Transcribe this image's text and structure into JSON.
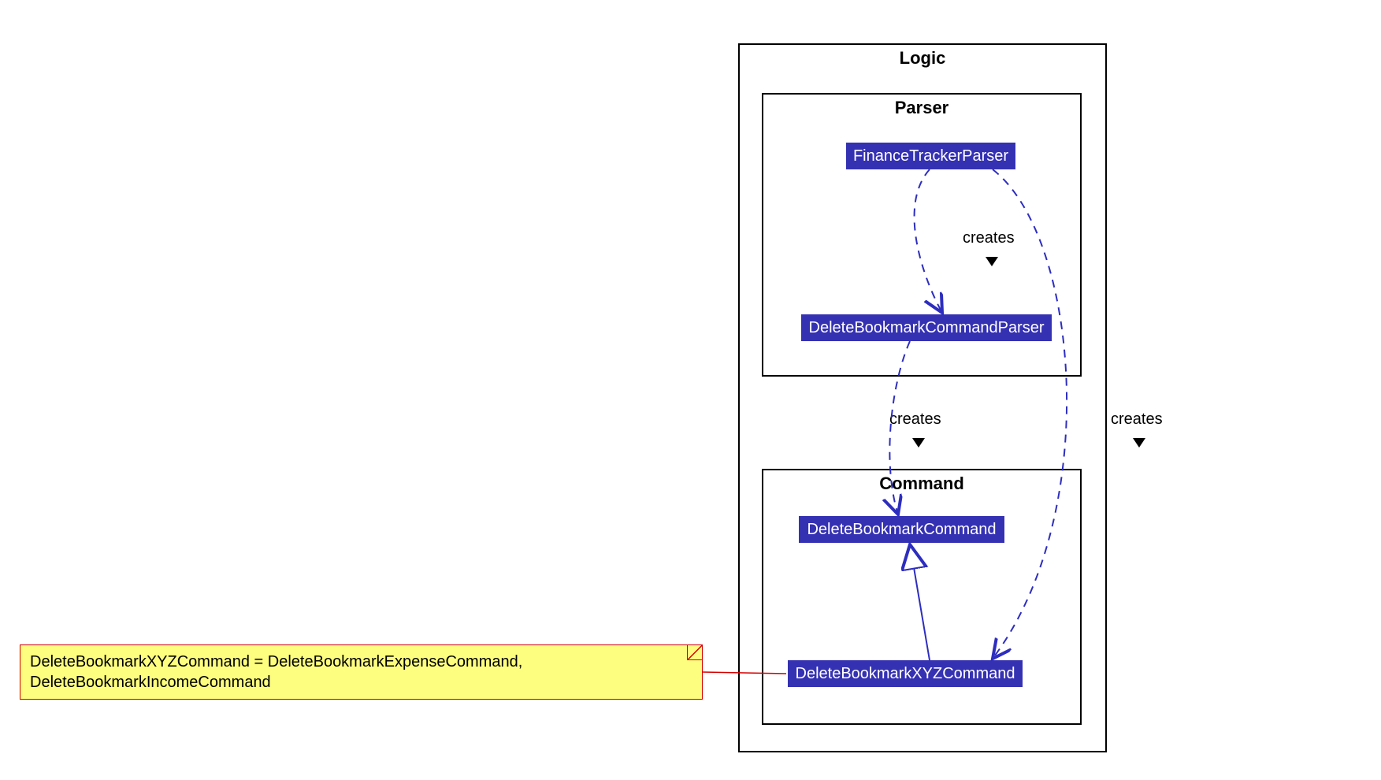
{
  "logic_frame": {
    "title": "Logic"
  },
  "parser_frame": {
    "title": "Parser",
    "classes": {
      "finance_tracker_parser": "FinanceTrackerParser",
      "delete_bookmark_command_parser": "DeleteBookmarkCommandParser"
    }
  },
  "command_frame": {
    "title": "Command",
    "classes": {
      "delete_bookmark_command": "DeleteBookmarkCommand",
      "delete_bookmark_xyz_command": "DeleteBookmarkXYZCommand"
    }
  },
  "labels": {
    "creates_ftp_to_dbcp": "creates",
    "creates_dbcp_to_dbc": "creates",
    "creates_ftp_to_dbxyz": "creates"
  },
  "note": {
    "line1": "DeleteBookmarkXYZCommand = DeleteBookmarkExpenseCommand,",
    "line2": "DeleteBookmarkIncomeCommand"
  },
  "colors": {
    "class_bg": "#3531b3",
    "note_bg": "#fdfd7f",
    "note_border": "#d40000",
    "arrow": "#2d2dbf"
  }
}
